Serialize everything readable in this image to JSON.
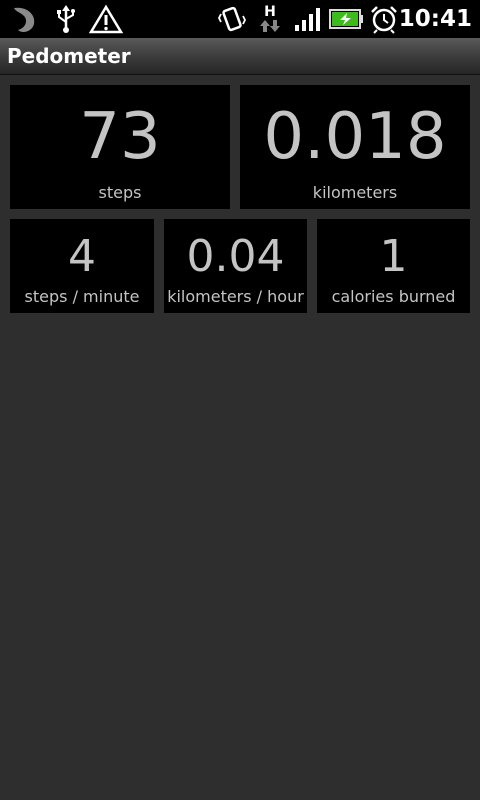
{
  "status_bar": {
    "time": "10:41",
    "network_label": "H",
    "icons": [
      "app-notification-icon",
      "usb-icon",
      "warning-icon",
      "vibrate-icon",
      "data-transfer-icon",
      "signal-icon",
      "battery-charging-icon",
      "alarm-icon"
    ],
    "battery_color": "#3dbb1d"
  },
  "app": {
    "title": "Pedometer"
  },
  "stats": {
    "steps": {
      "value": "73",
      "label": "steps"
    },
    "distance": {
      "value": "0.018",
      "label": "kilometers"
    },
    "pace": {
      "value": "4",
      "label": "steps / minute"
    },
    "speed": {
      "value": "0.04",
      "label": "kilometers / hour"
    },
    "calories": {
      "value": "1",
      "label": "calories burned"
    }
  }
}
